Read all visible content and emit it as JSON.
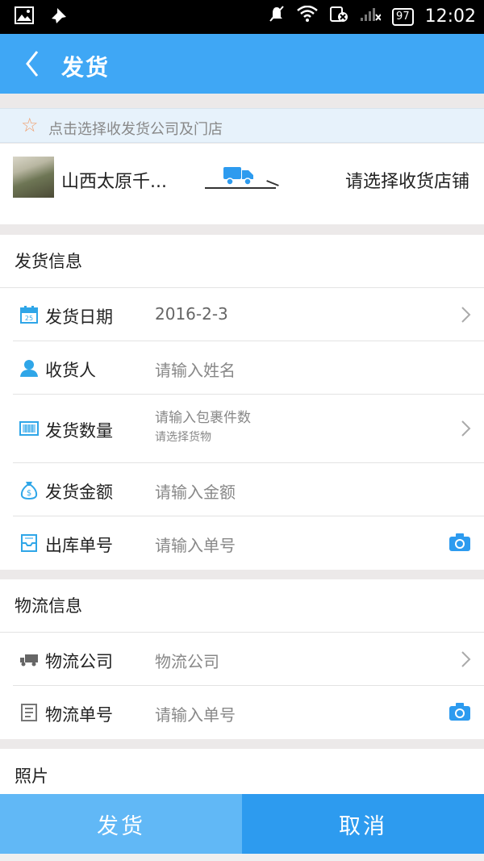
{
  "status_bar": {
    "time": "12:02",
    "battery": "97"
  },
  "header": {
    "title": "发货"
  },
  "tip": {
    "text": "点击选择收发货公司及门店"
  },
  "company": {
    "sender_name": "山西太原千...",
    "receiver_placeholder": "请选择收货店铺"
  },
  "shipping_info": {
    "title": "发货信息",
    "date": {
      "label": "发货日期",
      "value": "2016-2-3"
    },
    "receiver": {
      "label": "收货人",
      "placeholder": "请输入姓名"
    },
    "quantity": {
      "label": "发货数量",
      "placeholder": "请输入包裹件数",
      "sub": "请选择货物"
    },
    "amount": {
      "label": "发货金额",
      "placeholder": "请输入金额"
    },
    "outbound": {
      "label": "出库单号",
      "placeholder": "请输入单号"
    }
  },
  "logistics_info": {
    "title": "物流信息",
    "company": {
      "label": "物流公司",
      "placeholder": "物流公司"
    },
    "tracking": {
      "label": "物流单号",
      "placeholder": "请输入单号"
    }
  },
  "photo": {
    "title": "照片"
  },
  "actions": {
    "ship_label": "发货",
    "cancel_label": "取消"
  },
  "colors": {
    "primary": "#3fa7f5",
    "ship_button": "#61b8f6",
    "cancel_button": "#2d9bef",
    "tip_bg": "#e7f2fb"
  },
  "icons": [
    "image-icon",
    "pin-icon",
    "mute-icon",
    "wifi-icon",
    "sim-icon",
    "signal-icon",
    "battery-icon",
    "back-icon",
    "star-icon",
    "truck-icon",
    "calendar-icon",
    "person-icon",
    "box-icon",
    "money-bag-icon",
    "inbox-icon",
    "chevron-right-icon",
    "camera-icon",
    "document-icon"
  ]
}
